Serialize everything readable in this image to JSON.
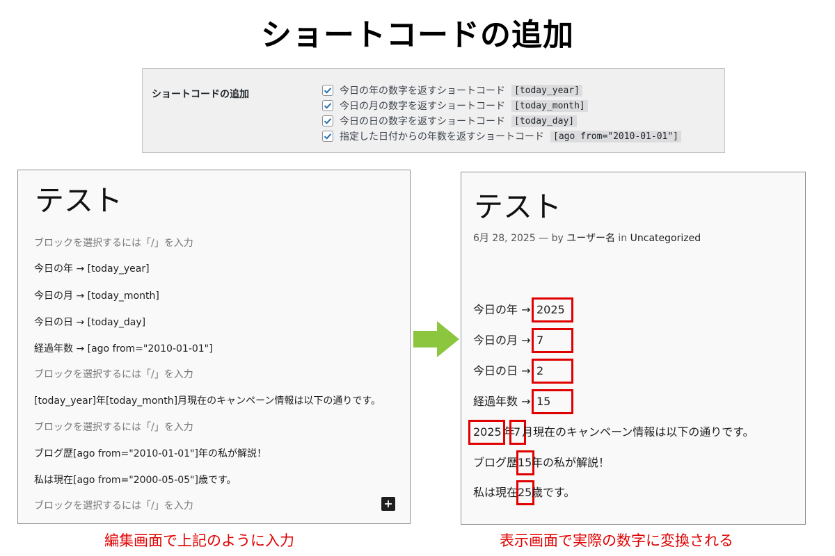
{
  "title": "ショートコードの追加",
  "settings": {
    "label": "ショートコードの追加",
    "options": [
      {
        "label": "今日の年の数字を返すショートコード",
        "code": "[today_year]",
        "checked": true
      },
      {
        "label": "今日の月の数字を返すショートコード",
        "code": "[today_month]",
        "checked": true
      },
      {
        "label": "今日の日の数字を返すショートコード",
        "code": "[today_day]",
        "checked": true
      },
      {
        "label": "指定した日付からの年数を返すショートコード",
        "code": "[ago from=\"2010-01-01\"]",
        "checked": true
      }
    ]
  },
  "editor": {
    "title": "テスト",
    "lines": [
      "ブロックを選択するには「/」を入力",
      "今日の年 → [today_year]",
      "今日の月 → [today_month]",
      "今日の日 → [today_day]",
      "経過年数 → [ago from=\"2010-01-01\"]",
      "ブロックを選択するには「/」を入力",
      "[today_year]年[today_month]月現在のキャンペーン情報は以下の通りです。",
      "ブロックを選択するには「/」を入力",
      "ブログ歴[ago from=\"2010-01-01\"]年の私が解説！",
      "私は現在[ago from=\"2000-05-05\"]歳です。",
      "ブロックを選択するには「/」を入力"
    ],
    "add_block_icon": "plus-icon"
  },
  "preview": {
    "title": "テスト",
    "meta": {
      "date": "6月 28, 2025",
      "dash": "—",
      "by": "by",
      "author": "ユーザー名",
      "in": "in",
      "category": "Uncategorized"
    },
    "lines": {
      "year_label": "今日の年 →",
      "year_value": "2025",
      "month_label": "今日の月 →",
      "month_value": "7",
      "day_label": "今日の日 →",
      "day_value": "2",
      "elapsed_label": "経過年数 →",
      "elapsed_value": "15",
      "campaign_year": "2025",
      "campaign_year_suffix": "年",
      "campaign_month": "7",
      "campaign_rest": "月現在のキャンペーン情報は以下の通りです。",
      "blog_prefix": "ブログ歴",
      "blog_value": "15",
      "blog_rest": "年の私が解説！",
      "age_prefix": "私は現在",
      "age_value": "25",
      "age_rest": "歳です。"
    }
  },
  "captions": {
    "left": "編集画面で上記のように入力",
    "right": "表示画面で実際の数字に変換される"
  },
  "colors": {
    "highlight": "#e00000",
    "arrow": "#8cc63f",
    "checkbox": "#2271b1"
  }
}
